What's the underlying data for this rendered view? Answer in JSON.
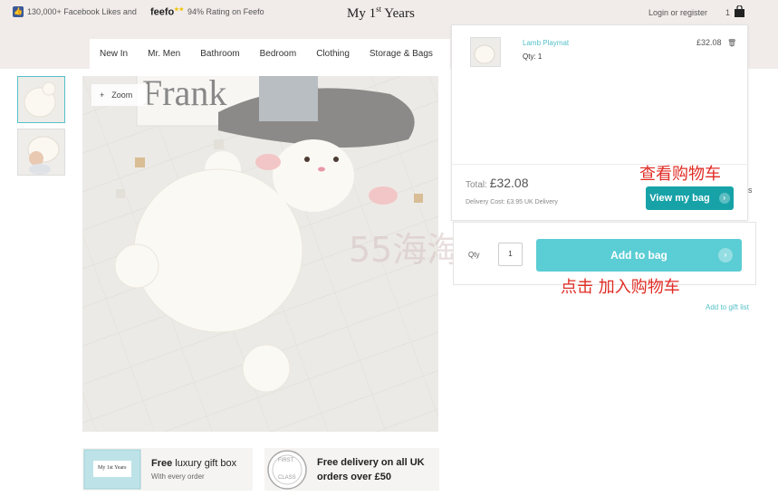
{
  "topbar": {
    "facebook_text": "130,000+ Facebook Likes and",
    "feefo_logo": "feefo",
    "feefo_stars": "★★",
    "feefo_text": "94% Rating on Feefo",
    "brand_main": "My 1",
    "brand_sup": "st",
    "brand_tail": " Years",
    "login": "Login or register",
    "bag_count": "1"
  },
  "nav": {
    "items": [
      {
        "label": "New In"
      },
      {
        "label": "Mr. Men"
      },
      {
        "label": "Bathroom"
      },
      {
        "label": "Bedroom"
      },
      {
        "label": "Clothing"
      },
      {
        "label": "Storage & Bags"
      }
    ]
  },
  "gallery": {
    "zoom_label": "Zoom",
    "zoom_icon": "+",
    "image_text": "Frank",
    "watermark": "55海淘"
  },
  "minicart": {
    "item_name": "Lamb Playmat",
    "item_qty": "Qty: 1",
    "item_price": "£32.08",
    "total_label": "Total:",
    "total_value": "£32.08",
    "delivery": "Delivery Cost: £3.95 UK Delivery",
    "view_bag": "View my bag"
  },
  "annotations": {
    "view_cart": "查看购物车",
    "add_to_cart": "点击 加入购物车"
  },
  "purchase": {
    "qty_label": "Qty",
    "qty_value": "1",
    "add_to_bag": "Add to bag",
    "gift_list": "Add to gift list",
    "stray_text": "s"
  },
  "promos": {
    "gift_box_lead": "Free",
    "gift_box_rest": " luxury gift box",
    "gift_box_sub": "With every order",
    "gift_box_logo": "My 1st Years",
    "delivery_line1": "Free delivery on all UK",
    "delivery_line2": "orders over £50",
    "stamp_top": "FIRST",
    "stamp_bottom": "CLASS"
  },
  "colors": {
    "accent_teal": "#17a2a8",
    "button_teal": "#5bcdd4",
    "link_teal": "#55c0c8",
    "annotation_red": "#e02c24",
    "topbar_bg": "#f1ecea"
  }
}
